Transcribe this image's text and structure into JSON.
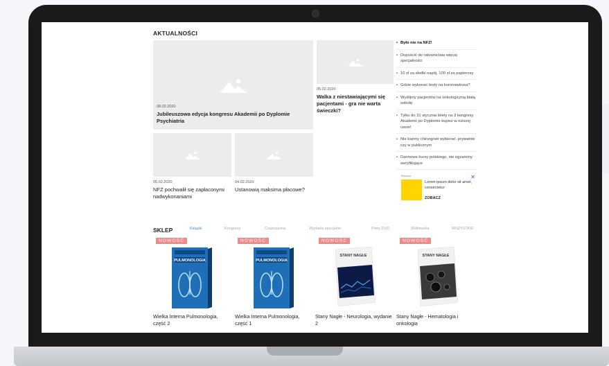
{
  "news": {
    "title": "AKTUALNOŚCI",
    "articles": [
      {
        "date": "08.02.2020",
        "title": "Jubileuszowa edycja kongresu Akademii po Dyplomie Psychiatria"
      },
      {
        "date": "05.02.2020",
        "title": "Walka z niestawiającymi się pacjentami - gra nie warta świeczki?"
      },
      {
        "date": "05.02.2020",
        "title": "NFZ pochwalił się zapłaconymi nadwykonaniami"
      },
      {
        "date": "04.02.2020",
        "title": "Ustanowią maksima płacowe?"
      }
    ],
    "sidebar": [
      "Było nie na NFZ!",
      "Dopuścić do ratownictwa więcej specjalności",
      "10 zł za słodki napój, 100 zł za papierosy",
      "Gdzie wykonać testy na koronawirusa?",
      "Wyślijmy pacjentów na onkologiczną białą sobotę",
      "Tylko do 31 stycznia bilety na 3 kongresy Akademii po Dyplomie kupisz w niższej cenie!",
      "Nie każmy chirurgowi wybierać: prywatnie czy w publicznym",
      "Darmowe kursy polskiego, nie egzaminy weryfikujące"
    ],
    "ad": {
      "label": "Reklama",
      "text": "Lorem ipsum dolor sit amet, consectetur",
      "cta": "ZOBACZ",
      "close": "✕"
    }
  },
  "shop": {
    "title": "SKLEP",
    "tabs": [
      "Książki",
      "Kongresy",
      "Czasopisma",
      "Wydania specjalne",
      "Filmy DVD",
      "Multimedia",
      "WSZYSTKIE"
    ],
    "badge": "NOWOŚĆ",
    "products": [
      {
        "name": "Wielka Interna Pulmonologia, część 2",
        "cover_title": "PULMONOLOGIA",
        "cover_top": "Wielka INTERNA"
      },
      {
        "name": "Wielka Interna Pulmonologia, część 1",
        "cover_title": "PULMONOLOGIA",
        "cover_top": "Wielka INTERNA"
      },
      {
        "name": "Stany Nagłe - Neurologia, wydanie 2",
        "cover_title": "STANY NAGŁE",
        "cover_top": ""
      },
      {
        "name": "Stany Nagłe - Hematologia i onkologia",
        "cover_title": "STANY NAGŁE",
        "cover_top": ""
      }
    ]
  },
  "colors": {
    "accent": "#3f8ae0",
    "badge": "#f08a88",
    "frame": "#1a1a1a",
    "ad_logo": "#ffd400"
  }
}
